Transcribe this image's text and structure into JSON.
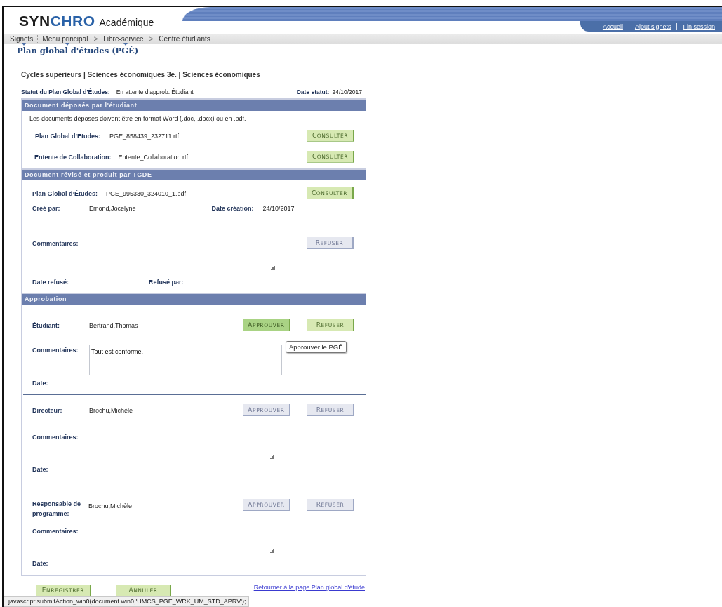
{
  "header": {
    "logo": {
      "dark": "SYN",
      "accent": "CHRO",
      "suffix": "Académique"
    },
    "links": [
      {
        "label": "Accueil"
      },
      {
        "label": "Ajout signets"
      },
      {
        "label": "Fin session"
      }
    ]
  },
  "breadcrumb": [
    {
      "label": "Signets",
      "dropdown": true
    },
    {
      "label": "Menu principal",
      "dropdown": true
    },
    {
      "label": "Libre-service",
      "dropdown": true,
      "separator": ">"
    },
    {
      "label": "Centre étudiants",
      "dropdown": false,
      "separator": ">"
    }
  ],
  "page_title": "Plan global d'études (PGÉ)",
  "program_line": "Cycles supérieurs | Sciences économiques 3e. | Sciences économiques",
  "status": {
    "label": "Statut du Plan Global d'Études:",
    "value": "En attente d'approb. Étudiant",
    "date_label": "Date statut:",
    "date": "24/10/2017"
  },
  "documents": {
    "title": "Document déposés par l'étudiant",
    "note": "Les documents déposés doivent être en format Word (.doc, .docx) ou en .pdf.",
    "rows": [
      {
        "label": "Plan Global d’Études:",
        "file": "PGE_858439_232711.rtf",
        "button": {
          "label": "CONSULTER",
          "disabled": false,
          "hovered": false
        }
      },
      {
        "label": "Entente de Collaboration:",
        "file": "Entente_Collaboration.rtf",
        "button": {
          "label": "CONSULTER",
          "disabled": false,
          "hovered": false
        }
      }
    ]
  },
  "revised": {
    "title": "Document révisé et produit par TGDE",
    "row": {
      "label": "Plan Global d’Études:",
      "file": "PGE_995330_324010_1.pdf",
      "button": {
        "label": "CONSULTER",
        "disabled": false,
        "hovered": false
      }
    },
    "created_label": "Créé par:",
    "created_by": "Emond,Jocelyne",
    "date_label": "Date création:",
    "date": "24/10/2017",
    "comments_label": "Commentaires:",
    "refuse_button": {
      "label": "REFUSER",
      "disabled": true,
      "hovered": false
    },
    "refused_date_label": "Date refusé:",
    "refused_by_label": "Refusé par:"
  },
  "approval": {
    "title": "Approbation",
    "approvers": [
      {
        "role": "Étudiant:",
        "name": "Bertrand,Thomas",
        "approve": {
          "label": "APPROUVER",
          "disabled": false,
          "hovered": true
        },
        "refuse": {
          "label": "REFUSER",
          "disabled": false,
          "hovered": false
        },
        "comments_label": "Commentaires:",
        "comment_editable": true,
        "comment": "Tout est conforme.",
        "tooltip": "Approuver le PGÉ",
        "date_label": "Date:"
      },
      {
        "role": "Directeur:",
        "name": "Brochu,Michèle",
        "approve": {
          "label": "APPROUVER",
          "disabled": true,
          "hovered": false
        },
        "refuse": {
          "label": "REFUSER",
          "disabled": true,
          "hovered": false
        },
        "comments_label": "Commentaires:",
        "comment_editable": false,
        "date_label": "Date:"
      },
      {
        "role": "Responsable de programme:",
        "name": "Brochu,Michèle",
        "approve": {
          "label": "APPROUVER",
          "disabled": true,
          "hovered": false
        },
        "refuse": {
          "label": "REFUSER",
          "disabled": true,
          "hovered": false
        },
        "comments_label": "Commentaires:",
        "comment_editable": false,
        "date_label": "Date:"
      }
    ]
  },
  "footer": {
    "buttons": [
      {
        "label": "ENREGISTRER",
        "disabled": false,
        "hovered": false
      },
      {
        "label": "ANNULER",
        "disabled": false,
        "hovered": false
      }
    ],
    "link": "Retourner à la page Plan global d'étude"
  },
  "status_bar": "javascript:submitAction_win0(document.win0,'UMCS_PGE_WRK_UM_STD_APRV');"
}
